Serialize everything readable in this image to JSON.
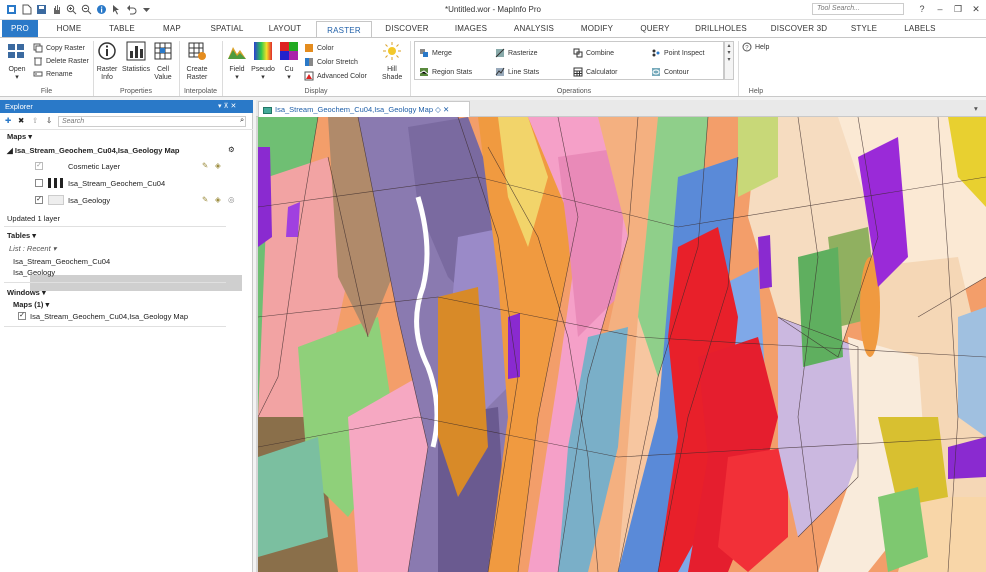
{
  "app": {
    "title": "*Untitled.wor - MapInfo Pro",
    "tool_search_placeholder": "Tool Search..."
  },
  "tabs": [
    "PRO",
    "HOME",
    "TABLE",
    "MAP",
    "SPATIAL",
    "LAYOUT",
    "RASTER",
    "DISCOVER",
    "IMAGES",
    "ANALYSIS",
    "MODIFY",
    "QUERY",
    "DRILLHOLES",
    "DISCOVER 3D",
    "STYLE",
    "LABELS"
  ],
  "active_tab": "RASTER",
  "ribbon": {
    "file": {
      "label": "File",
      "open": "Open",
      "copy_raster": "Copy Raster",
      "delete_raster": "Delete Raster",
      "rename": "Rename"
    },
    "properties": {
      "label": "Properties",
      "raster_info": "Raster Info",
      "statistics": "Statistics",
      "cell_value": "Cell Value"
    },
    "interpolate": {
      "label": "Interpolate",
      "create_raster": "Create Raster"
    },
    "display": {
      "label": "Display",
      "field": "Field",
      "pseudo": "Pseudo",
      "cu": "Cu",
      "color": "Color",
      "color_stretch": "Color Stretch",
      "advanced_color": "Advanced Color",
      "hill_shade": "Hill Shade"
    },
    "operations": {
      "label": "Operations",
      "merge": "Merge",
      "rasterize": "Rasterize",
      "combine": "Combine",
      "point_inspect": "Point Inspect",
      "region_stats": "Region Stats",
      "line_stats": "Line Stats",
      "calculator": "Calculator",
      "contour": "Contour"
    },
    "help": {
      "label": "Help",
      "help": "Help"
    }
  },
  "explorer": {
    "title": "Explorer",
    "search_placeholder": "Search",
    "maps_header": "Maps",
    "map_name": "Isa_Stream_Geochem_Cu04,Isa_Geology Map",
    "layers": [
      "Cosmetic Layer",
      "Isa_Stream_Geochem_Cu04",
      "Isa_Geology"
    ],
    "status": "Updated 1 layer",
    "tables_header": "Tables",
    "tables_list_label": "List : Recent",
    "tables": [
      "Isa_Stream_Geochem_Cu04",
      "Isa_Geology"
    ],
    "windows_header": "Windows",
    "windows_maps": "Maps (1)",
    "windows_item": "Isa_Stream_Geochem_Cu04,Isa_Geology Map"
  },
  "document_tab": "Isa_Stream_Geochem_Cu04,Isa_Geology Map",
  "colors": {
    "accent": "#2a79c8",
    "ribbon_bg": "#ffffff",
    "panel_bg": "#ffffff"
  }
}
